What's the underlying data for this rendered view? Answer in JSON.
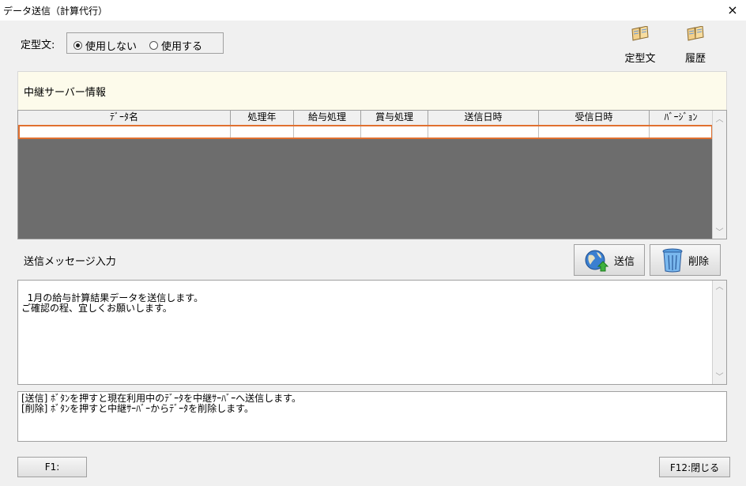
{
  "window": {
    "title": "データ送信（計算代行）",
    "close_label": "×"
  },
  "template_option": {
    "label": "定型文:",
    "options": [
      {
        "label": "使用しない",
        "selected": true
      },
      {
        "label": "使用する",
        "selected": false
      }
    ]
  },
  "toolbar": {
    "template_label": "定型文",
    "history_label": "履歴"
  },
  "relay_info": {
    "label": "中継サーバー情報",
    "columns": [
      "ﾃﾞｰﾀ名",
      "処理年",
      "給与処理",
      "賞与処理",
      "送信日時",
      "受信日時",
      "ﾊﾞｰｼﾞｮﾝ"
    ],
    "rows": []
  },
  "message": {
    "label": "送信メッセージ入力",
    "send_label": "送信",
    "delete_label": "削除",
    "text": "1月の給与計算結果データを送信します。\nご確認の程、宜しくお願いします。"
  },
  "help": {
    "line1": "[送信] ﾎﾞﾀﾝを押すと現在利用中のﾃﾞｰﾀを中継ｻｰﾊﾞｰへ送信します。",
    "line2": "[削除] ﾎﾞﾀﾝを押すと中継ｻｰﾊﾞｰからﾃﾞｰﾀを削除します。"
  },
  "footer": {
    "f1_label": "F1:",
    "f12_label": "F12:閉じる"
  },
  "colors": {
    "panel_bg": "#fdfbeb",
    "grid_bg": "#6d6d6d",
    "selected_row_border": "#e07030"
  }
}
